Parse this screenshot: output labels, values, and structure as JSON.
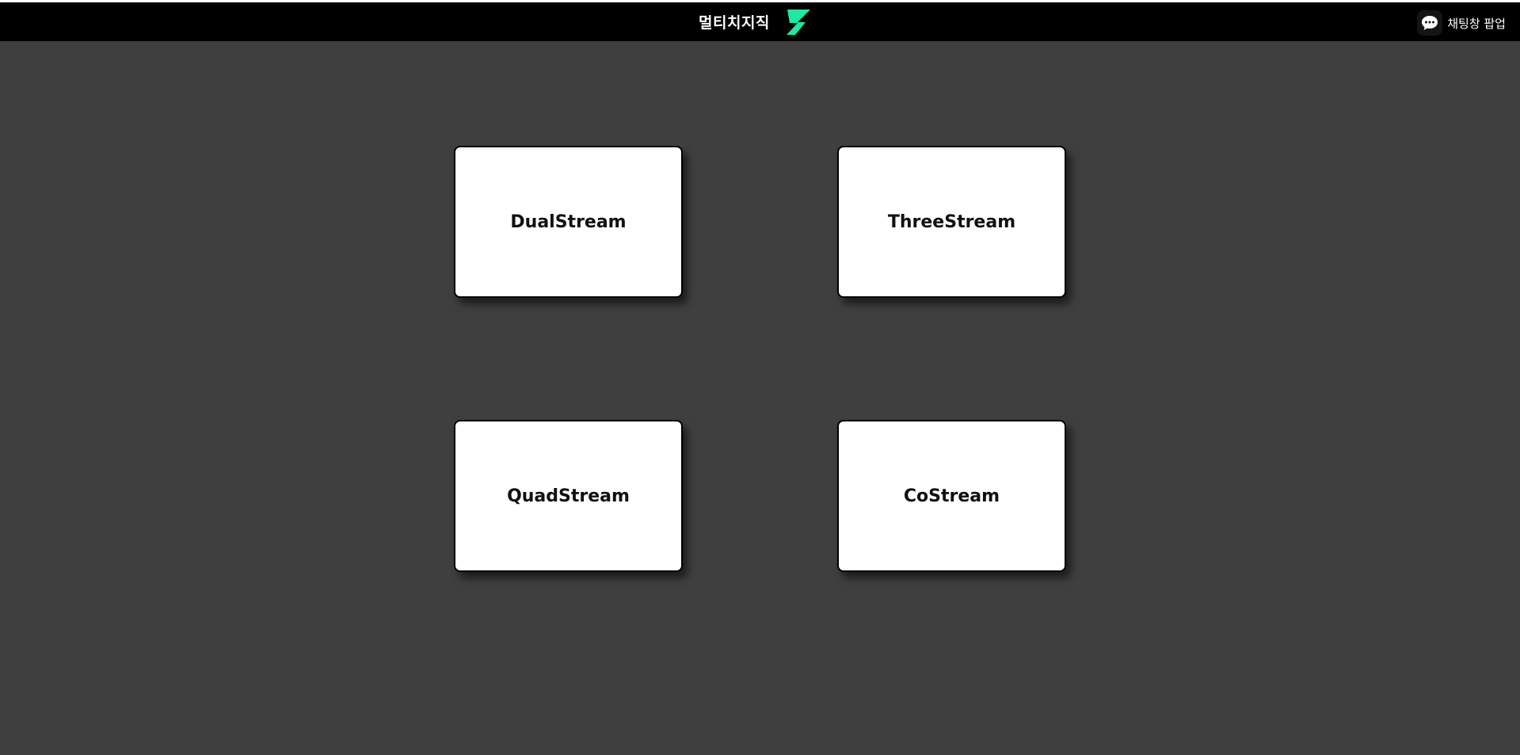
{
  "header": {
    "title": "멀티치지직",
    "logo_icon": "chzzk-logo-icon",
    "accent_color": "#1de9a5",
    "chat_popup": {
      "label": "채팅창 팝업",
      "icon": "chat-bubble-icon"
    }
  },
  "main": {
    "cards": [
      {
        "label": "DualStream"
      },
      {
        "label": "ThreeStream"
      },
      {
        "label": "QuadStream"
      },
      {
        "label": "CoStream"
      }
    ]
  },
  "colors": {
    "header_bg": "#000000",
    "page_bg": "#3f3f3f",
    "card_bg": "#ffffff"
  }
}
